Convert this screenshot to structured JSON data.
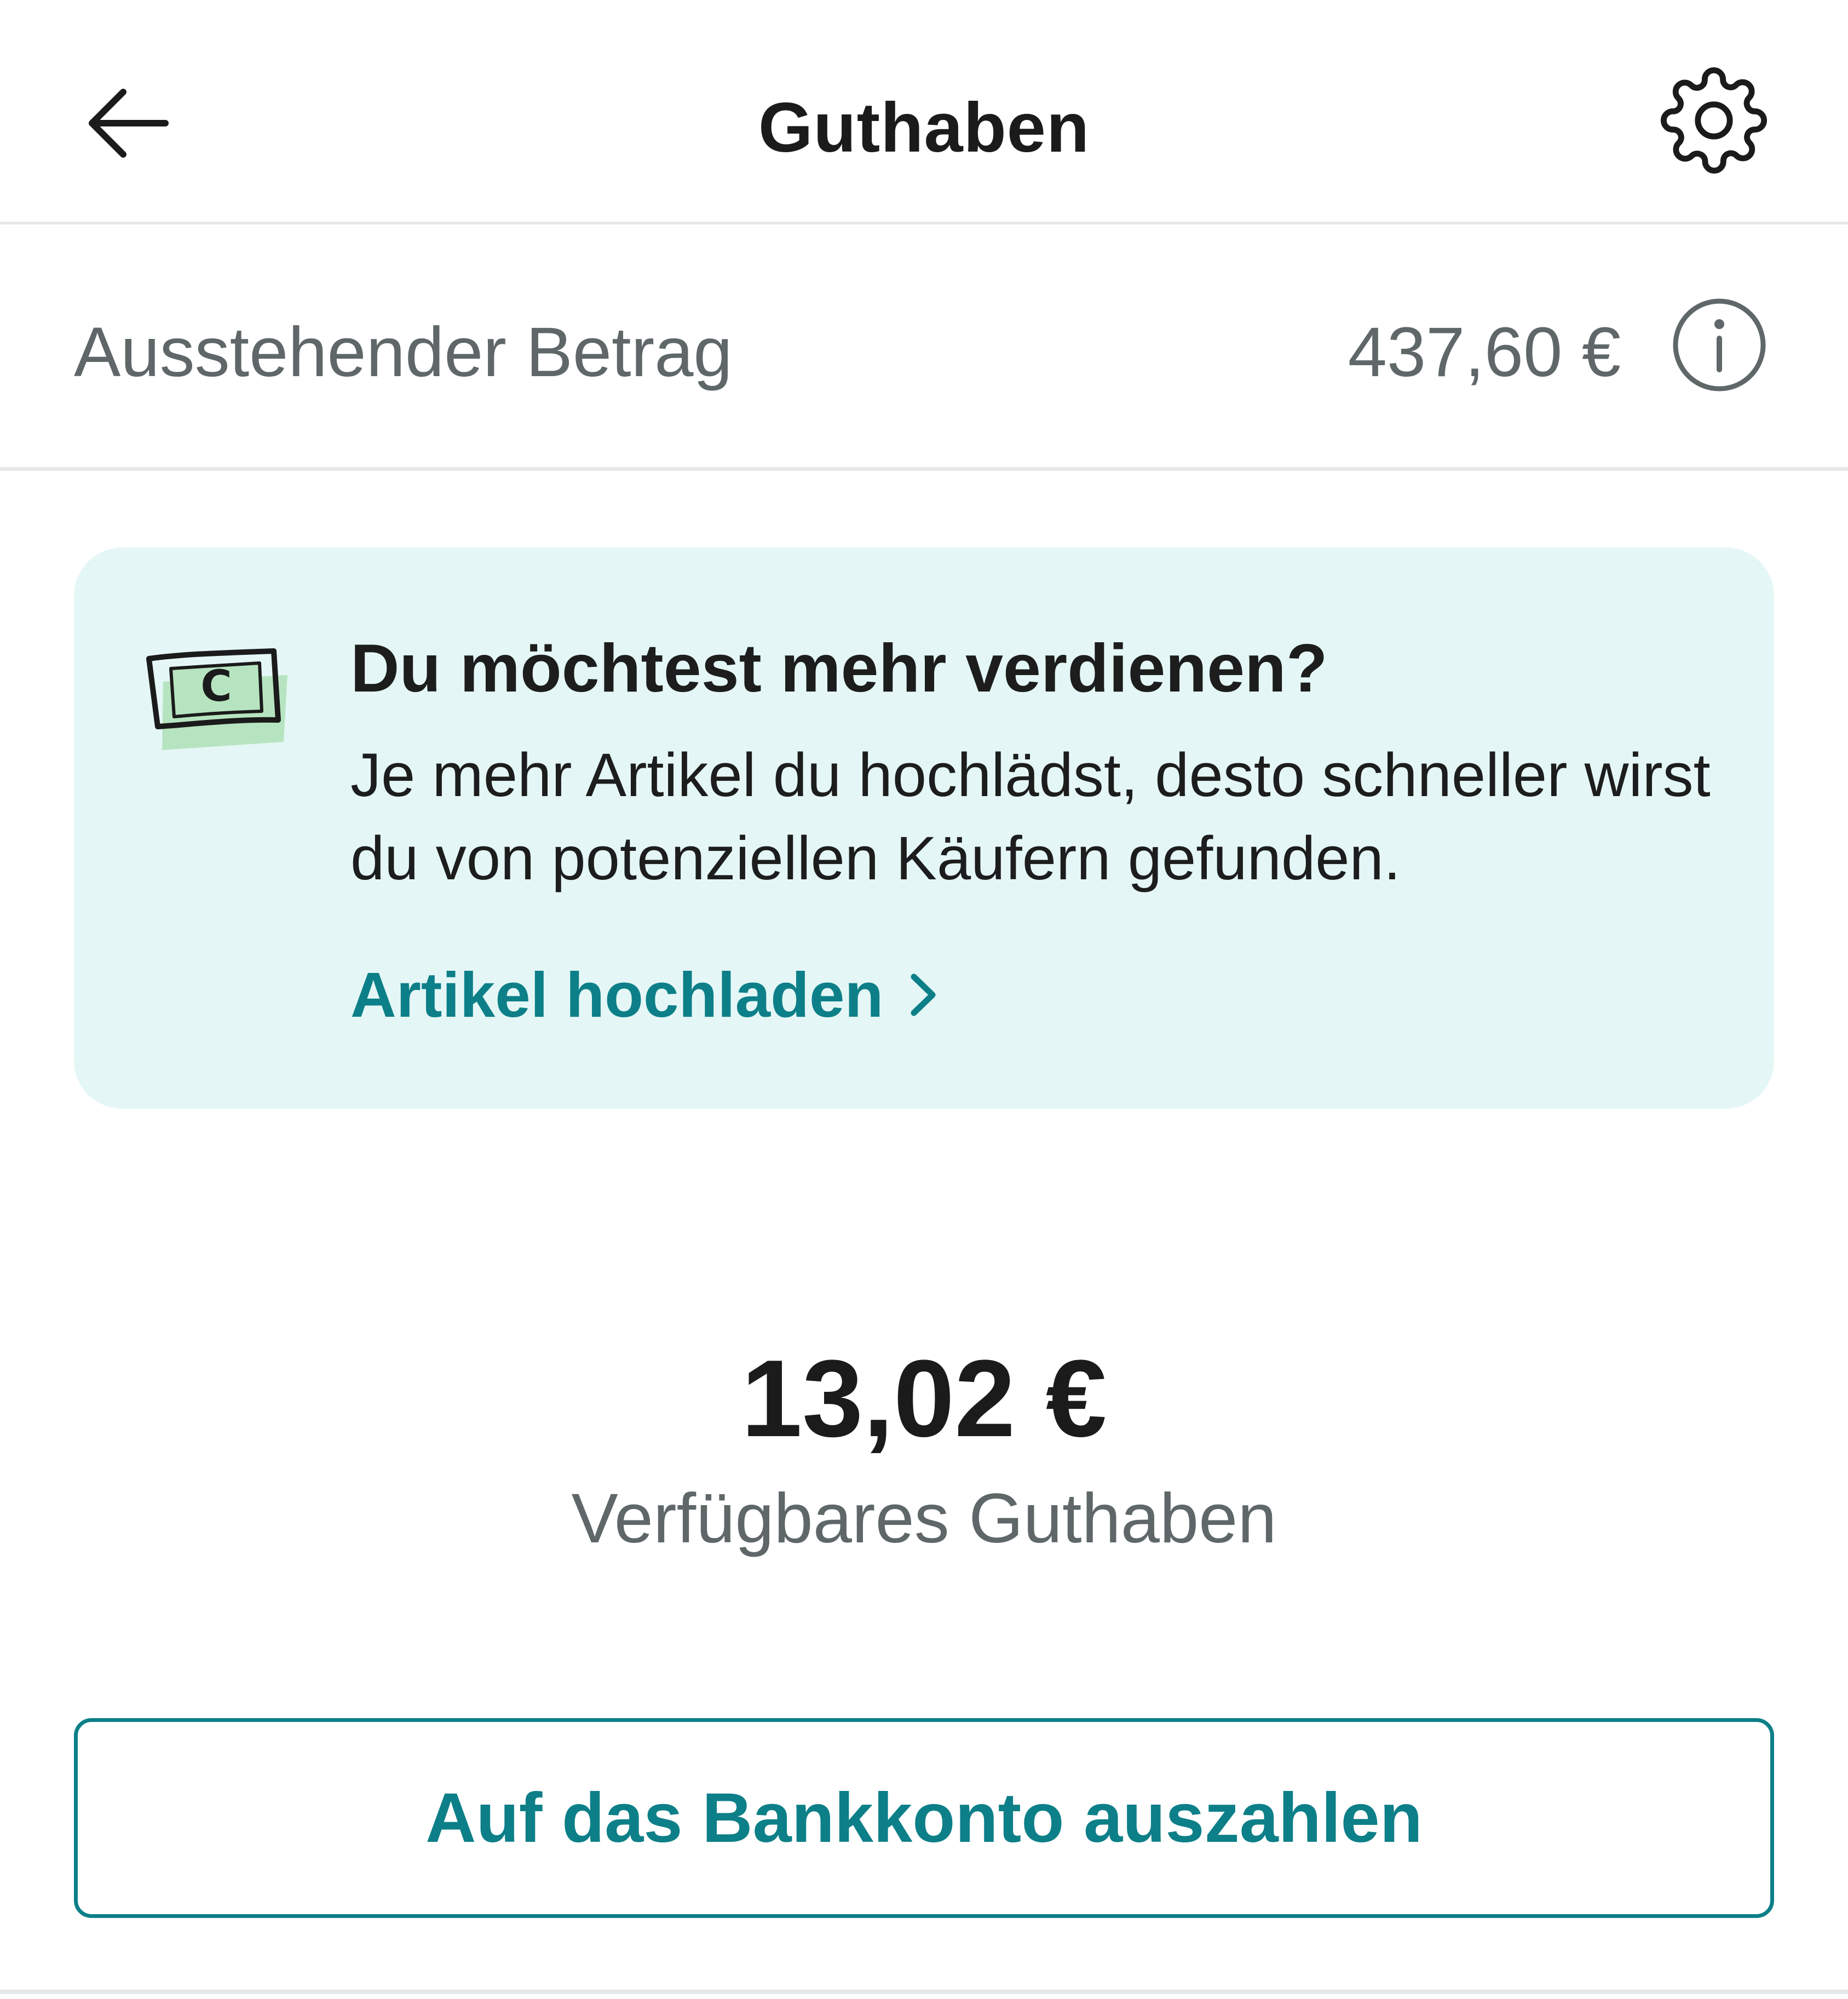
{
  "header": {
    "title": "Guthaben",
    "back_icon": "arrow-left-icon",
    "settings_icon": "gear-icon"
  },
  "pending": {
    "label": "Ausstehender Betrag",
    "amount": "437,60 €",
    "info_icon": "info-icon"
  },
  "promo": {
    "icon": "banknote-icon",
    "icon_letter": "C",
    "title": "Du möchtest mehr verdienen?",
    "text": "Je mehr Artikel du hochlädst, desto schneller wirst du von potenziellen Käufern gefunden.",
    "link_label": "Artikel hochladen",
    "link_icon": "chevron-right-icon"
  },
  "balance": {
    "amount": "13,02 €",
    "label": "Verfügbares Guthaben"
  },
  "payout_button": {
    "label": "Auf das Bankkonto auszahlen"
  },
  "colors": {
    "accent": "#0d7f88",
    "card_background": "#e4f7f6",
    "muted_text": "#5f6768",
    "divider": "#e6e8e8"
  }
}
